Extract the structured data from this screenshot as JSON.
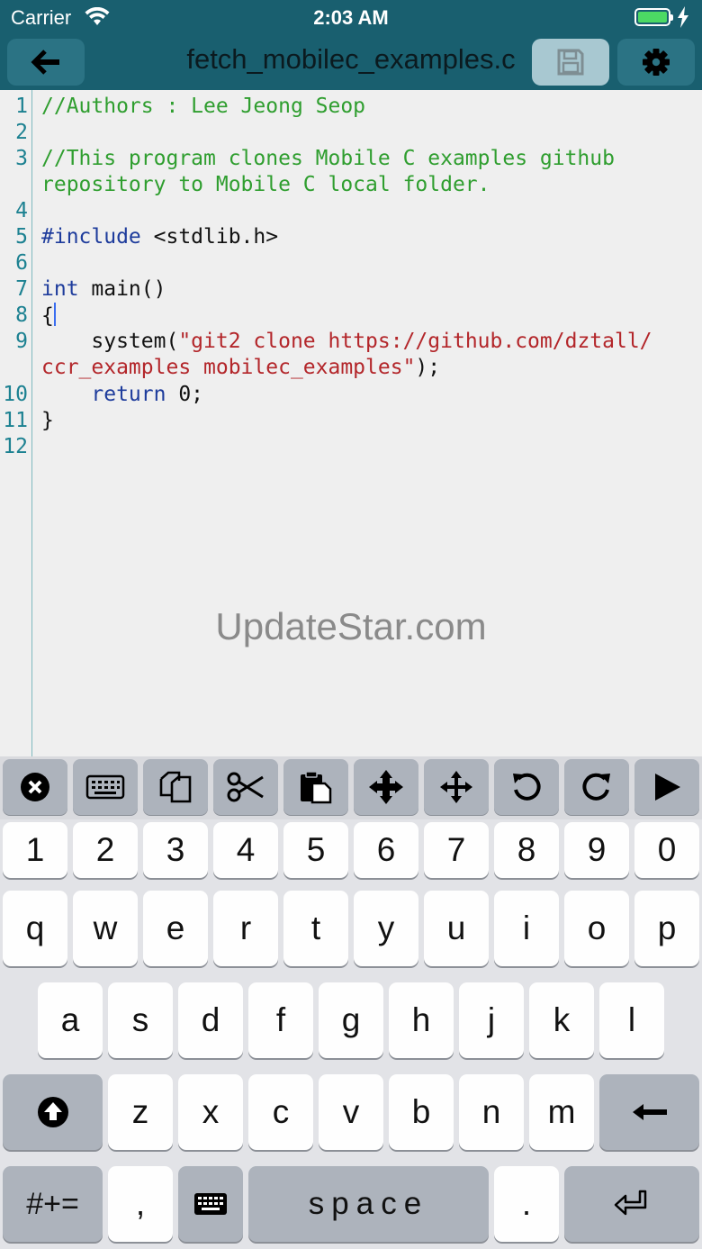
{
  "status_bar": {
    "carrier": "Carrier",
    "time": "2:03 AM"
  },
  "nav": {
    "title": "fetch_mobilec_examples.c"
  },
  "editor": {
    "line_numbers": [
      "1",
      "2",
      "3",
      "4",
      "5",
      "6",
      "7",
      "8",
      "9",
      "10",
      "11",
      "12"
    ],
    "lines": {
      "l1": "//Authors : Lee Jeong Seop",
      "l3a": "//This program clones Mobile C examples github",
      "l3b": "repository to Mobile C local folder.",
      "l5_kw": "#include",
      "l5_rest": " <stdlib.h>",
      "l7_kw": "int",
      "l7_rest": " main()",
      "l8": "{",
      "l9_pre": "    system(",
      "l9_str": "\"git2 clone https://github.com/dztall/",
      "l9b_str": "ccr_examples mobilec_examples\"",
      "l9b_post": ");",
      "l10_pre": "    ",
      "l10_kw": "return",
      "l10_rest": " 0;",
      "l11": "}"
    }
  },
  "watermark": "UpdateStar.com",
  "toolbar": [
    "close-icon",
    "keyboard-icon",
    "copy-icon",
    "cut-icon",
    "paste-icon",
    "move-select-icon",
    "move-cursor-icon",
    "undo-icon",
    "redo-icon",
    "run-icon"
  ],
  "keyboard": {
    "row1": [
      "1",
      "2",
      "3",
      "4",
      "5",
      "6",
      "7",
      "8",
      "9",
      "0"
    ],
    "row2": [
      "q",
      "w",
      "e",
      "r",
      "t",
      "y",
      "u",
      "i",
      "o",
      "p"
    ],
    "row3": [
      "a",
      "s",
      "d",
      "f",
      "g",
      "h",
      "j",
      "k",
      "l"
    ],
    "row4": [
      "z",
      "x",
      "c",
      "v",
      "b",
      "n",
      "m"
    ],
    "symbols_label": "#+=",
    "comma": ",",
    "space_label": "space",
    "period": "."
  },
  "colors": {
    "bar": "#195f6f",
    "comment": "#2f9e2f",
    "keyword": "#1e3c9c",
    "string": "#b3262a"
  }
}
